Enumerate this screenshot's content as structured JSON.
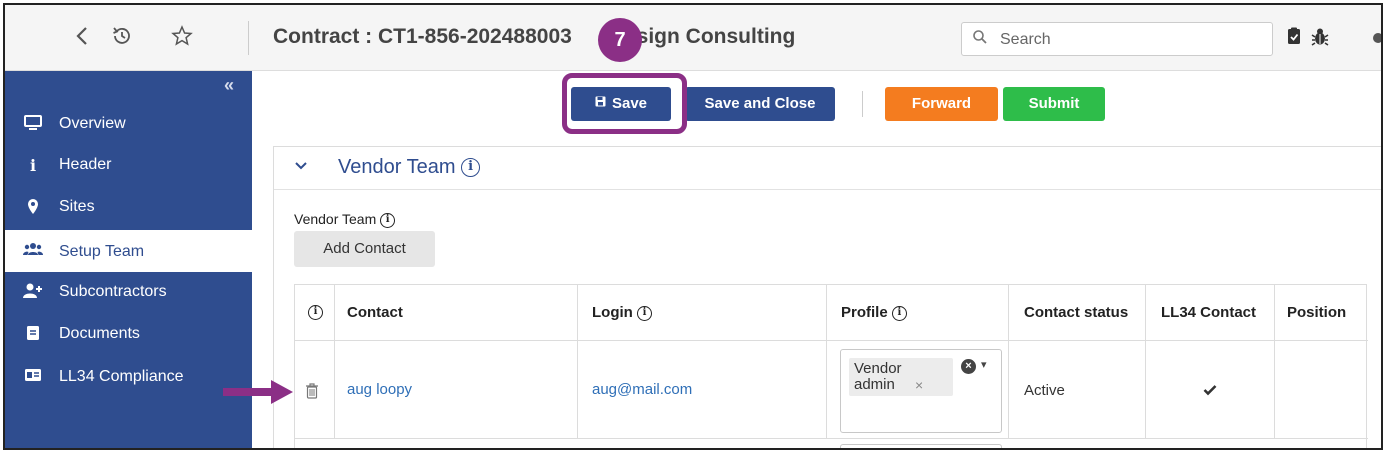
{
  "toolbar": {
    "back_icon": "chevron-left-icon",
    "history_icon": "history-icon",
    "favorite_icon": "star-icon",
    "title": "Contract : CT1-856-202488003",
    "title_suffix": "Design Consulting",
    "search_placeholder": "Search",
    "right_icons": [
      "clipboard-check-icon",
      "bug-icon"
    ]
  },
  "annotation": {
    "step": "7",
    "color": "#8b2f86"
  },
  "sidebar": {
    "collapse_label": "«",
    "items": [
      {
        "label": "Overview",
        "icon": "monitor-icon",
        "active": false
      },
      {
        "label": "Header",
        "icon": "info-icon",
        "active": false
      },
      {
        "label": "Sites",
        "icon": "map-pin-icon",
        "active": false
      },
      {
        "label": "Setup Team",
        "icon": "users-icon",
        "active": true
      },
      {
        "label": "Subcontractors",
        "icon": "user-plus-icon",
        "active": false
      },
      {
        "label": "Documents",
        "icon": "document-icon",
        "active": false
      },
      {
        "label": "LL34 Compliance",
        "icon": "id-card-icon",
        "active": false
      }
    ]
  },
  "actions": {
    "save": "Save",
    "save_and_close": "Save and Close",
    "forward": "Forward",
    "submit": "Submit"
  },
  "section": {
    "title": "Vendor Team",
    "sub_label": "Vendor Team",
    "add_contact": "Add Contact"
  },
  "table": {
    "columns": [
      "Contact",
      "Login",
      "Profile",
      "Contact status",
      "LL34 Contact",
      "Position"
    ],
    "rows": [
      {
        "contact": "aug loopy",
        "login": "aug@mail.com",
        "profile_line1": "Vendor",
        "profile_line2": "admin",
        "status": "Active",
        "ll34": true
      }
    ]
  },
  "colors": {
    "primary": "#2f4d8f",
    "forward": "#f47c1f",
    "submit": "#2ebd4a",
    "link": "#2f6fb7"
  }
}
